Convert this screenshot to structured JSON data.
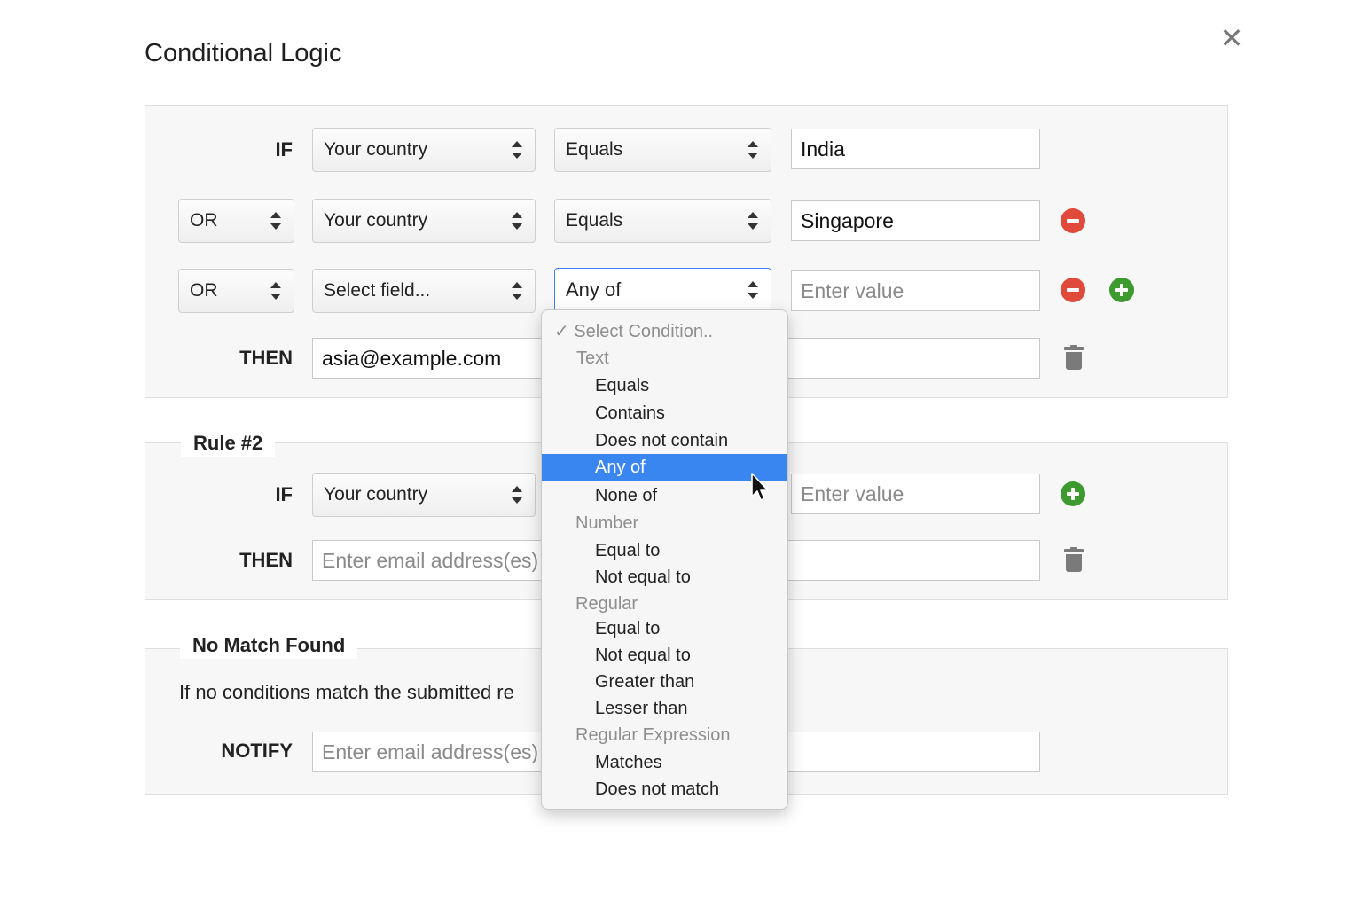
{
  "dialog": {
    "title": "Conditional Logic",
    "close_icon": "✕"
  },
  "rule1": {
    "row1": {
      "label": "IF",
      "field": "Your country",
      "condition": "Equals",
      "value": "India"
    },
    "row2": {
      "connector": "OR",
      "field": "Your country",
      "condition": "Equals",
      "value": "Singapore"
    },
    "row3": {
      "connector": "OR",
      "field": "Select field...",
      "condition": "Any of",
      "value_placeholder": "Enter value"
    },
    "then": {
      "label": "THEN",
      "value": "asia@example.com"
    }
  },
  "rule2": {
    "legend": "Rule #2",
    "if": {
      "label": "IF",
      "field": "Your country",
      "value_placeholder": "Enter value"
    },
    "then": {
      "label": "THEN",
      "placeholder": "Enter email address(es)"
    }
  },
  "no_match": {
    "legend": "No Match Found",
    "description": "If no conditions match the submitted re",
    "notify": {
      "label": "NOTIFY",
      "placeholder": "Enter email address(es)"
    }
  },
  "dropdown": {
    "placeholder": "Select Condition..",
    "check_icon": "✓",
    "groups": [
      {
        "label": "Text",
        "options": [
          "Equals",
          "Contains",
          "Does not contain",
          "Any of",
          "None of"
        ]
      },
      {
        "label": "Number",
        "options": [
          "Equal to",
          "Not equal to"
        ]
      },
      {
        "label": "Regular",
        "options": [
          "Equal to",
          "Not equal to",
          "Greater than",
          "Lesser than"
        ]
      },
      {
        "label": "Regular Expression",
        "options": [
          "Matches",
          "Does not match"
        ]
      }
    ],
    "highlighted": "Any of",
    "highlight_color": "#3a86f0"
  },
  "colors": {
    "remove": "#e04a3a",
    "add": "#3c9a2f",
    "focus_border": "#3b82f6"
  }
}
